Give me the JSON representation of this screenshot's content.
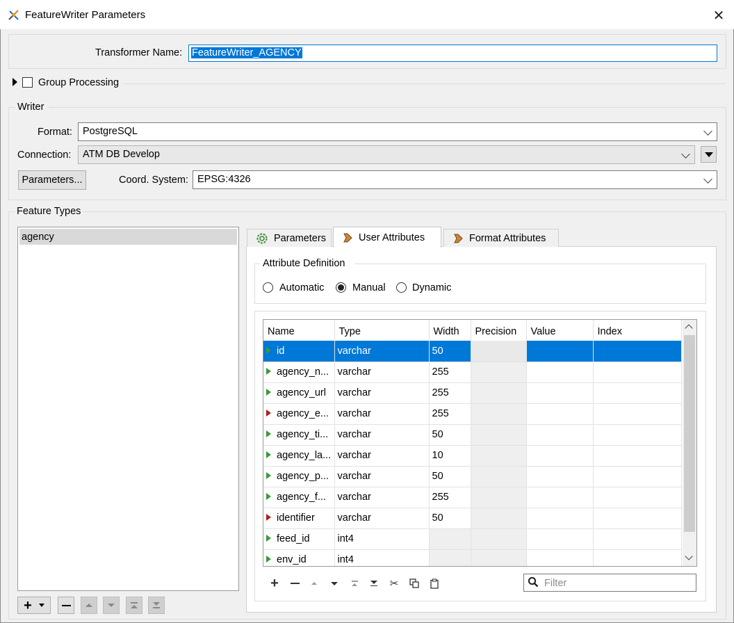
{
  "window": {
    "title": "FeatureWriter Parameters"
  },
  "transformer": {
    "label": "Transformer Name:",
    "value": "FeatureWriter_AGENCY"
  },
  "group_processing": {
    "label": "Group Processing",
    "checked": false
  },
  "writer": {
    "section_label": "Writer",
    "format_label": "Format:",
    "format_value": "PostgreSQL",
    "connection_label": "Connection:",
    "connection_value": "ATM DB Develop",
    "parameters_button": "Parameters...",
    "coord_label": "Coord. System:",
    "coord_value": "EPSG:4326"
  },
  "feature_types": {
    "section_label": "Feature Types",
    "items": [
      "agency"
    ]
  },
  "tabs": [
    {
      "label": "Parameters",
      "icon": "gear-icon",
      "active": false
    },
    {
      "label": "User Attributes",
      "icon": "arrow-icon",
      "active": true
    },
    {
      "label": "Format Attributes",
      "icon": "arrow-icon",
      "active": false
    }
  ],
  "attribute_definition": {
    "label": "Attribute Definition",
    "options": [
      "Automatic",
      "Manual",
      "Dynamic"
    ],
    "selected": "Manual"
  },
  "attributes_table": {
    "columns": [
      "Name",
      "Type",
      "Width",
      "Precision",
      "Value",
      "Index"
    ],
    "rows": [
      {
        "name": "id",
        "type": "varchar",
        "width": "50",
        "color": "#3a9a3a"
      },
      {
        "name": "agency_n...",
        "type": "varchar",
        "width": "255",
        "color": "#3a9a3a"
      },
      {
        "name": "agency_url",
        "type": "varchar",
        "width": "255",
        "color": "#3a9a3a"
      },
      {
        "name": "agency_e...",
        "type": "varchar",
        "width": "255",
        "color": "#b01e1e"
      },
      {
        "name": "agency_ti...",
        "type": "varchar",
        "width": "50",
        "color": "#3a9a3a"
      },
      {
        "name": "agency_la...",
        "type": "varchar",
        "width": "10",
        "color": "#3a9a3a"
      },
      {
        "name": "agency_p...",
        "type": "varchar",
        "width": "50",
        "color": "#3a9a3a"
      },
      {
        "name": "agency_f...",
        "type": "varchar",
        "width": "255",
        "color": "#3a9a3a"
      },
      {
        "name": "identifier",
        "type": "varchar",
        "width": "50",
        "color": "#b01e1e"
      },
      {
        "name": "feed_id",
        "type": "int4",
        "width": "",
        "color": "#3a9a3a"
      },
      {
        "name": "env_id",
        "type": "int4",
        "width": "",
        "color": "#3a9a3a"
      }
    ]
  },
  "filter": {
    "placeholder": "Filter"
  },
  "colors": {
    "accent": "#0078d7"
  }
}
